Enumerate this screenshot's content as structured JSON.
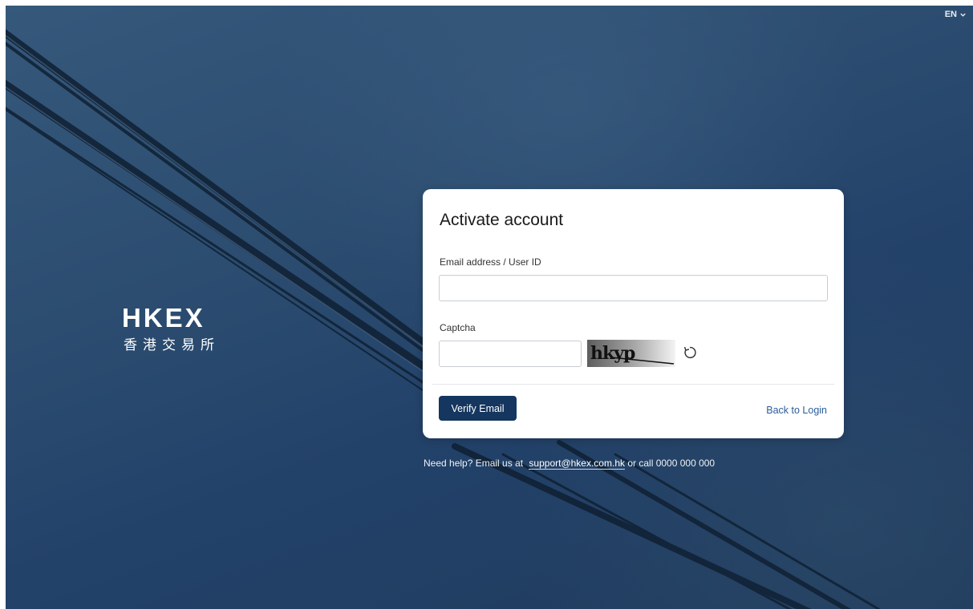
{
  "header": {
    "language": "EN"
  },
  "logo": {
    "text_en": "HKEX",
    "text_zh": "香港交易所"
  },
  "card": {
    "title": "Activate account",
    "email_label": "Email address / User ID",
    "email_value": "",
    "captcha_label": "Captcha",
    "captcha_value": "",
    "captcha_text": "hkyp",
    "verify_button": "Verify Email",
    "back_link": "Back to Login"
  },
  "help": {
    "prefix": "Need help? Email us at",
    "email": "support@hkex.com.hk",
    "suffix": "or call 0000 000 000"
  }
}
